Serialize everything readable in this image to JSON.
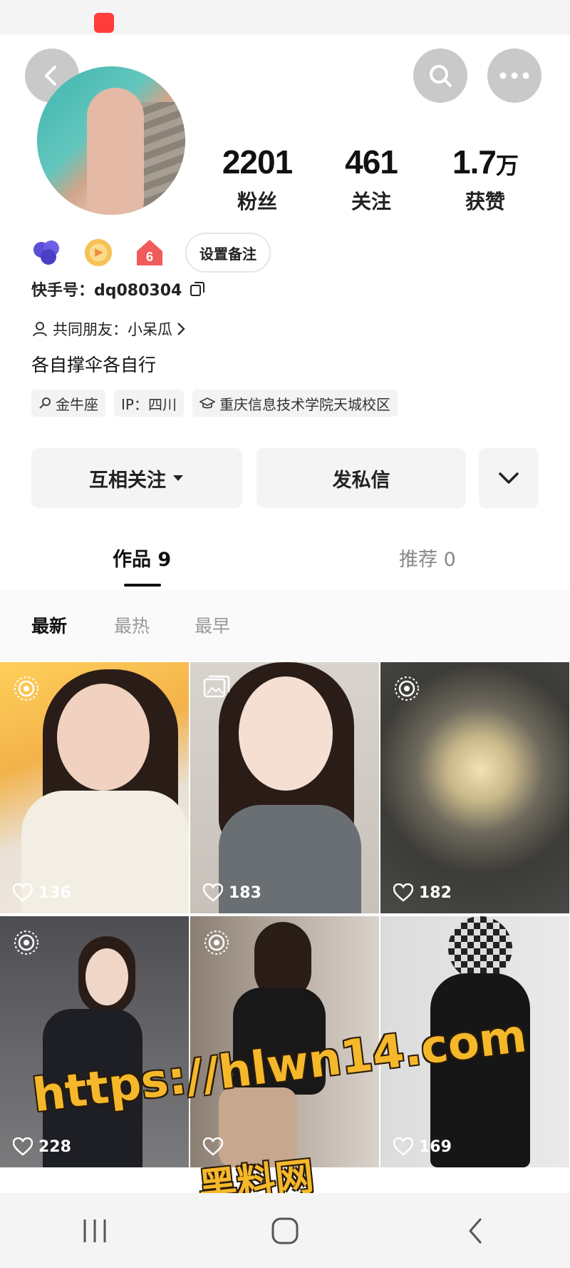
{
  "stats": [
    {
      "value": "2201",
      "unit": "",
      "label": "粉丝"
    },
    {
      "value": "461",
      "unit": "",
      "label": "关注"
    },
    {
      "value": "1.7",
      "unit": "万",
      "label": "获赞"
    }
  ],
  "badges": {
    "level_badge_number": "6",
    "note_button": "设置备注"
  },
  "profile": {
    "kwai_id": "快手号：dq080304",
    "mutual_friends": "共同朋友：小呆瓜",
    "bio": "各自撑伞各自行",
    "tags": [
      "金牛座",
      "IP：四川",
      "重庆信息技术学院天城校区"
    ]
  },
  "actions": {
    "follow": "互相关注",
    "message": "发私信"
  },
  "tabs": {
    "works": "作品 9",
    "recommended": "推荐 0"
  },
  "sort": [
    "最新",
    "最热",
    "最早"
  ],
  "posts": [
    {
      "likes": "136",
      "kind": "live-photo"
    },
    {
      "likes": "183",
      "kind": "photo-album"
    },
    {
      "likes": "182",
      "kind": "live-photo"
    },
    {
      "likes": "228",
      "kind": "live-photo"
    },
    {
      "likes": "",
      "kind": "live-photo"
    },
    {
      "likes": "169",
      "kind": "none"
    }
  ],
  "watermark": {
    "url": "https://hlwn14.com",
    "site": "黑料网"
  },
  "colors": {
    "accent": "#f5b82a",
    "button_bg": "#f4f4f4",
    "round_button": "#c9c9c9"
  }
}
